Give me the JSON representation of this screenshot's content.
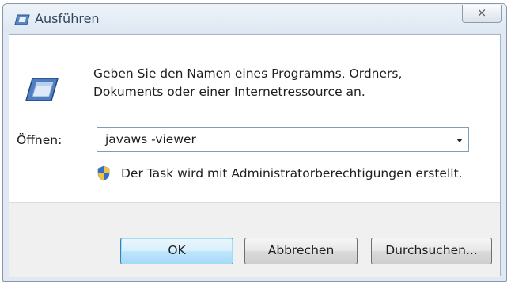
{
  "window": {
    "title": "Ausführen",
    "close_label": "⨯"
  },
  "dialog": {
    "description_line1": "Geben Sie den Namen eines Programms, Ordners,",
    "description_line2": "Dokuments oder einer Internetressource an.",
    "open_label": "Öffnen:",
    "open_value": "javaws -viewer",
    "admin_note": "Der Task wird mit Administratorberechtigungen erstellt."
  },
  "buttons": {
    "ok": "OK",
    "cancel": "Abbrechen",
    "browse": "Durchsuchen..."
  },
  "icons": {
    "title": "run-icon",
    "main": "run-icon",
    "shield": "shield-icon",
    "dropdown": "chevron-down-icon"
  }
}
